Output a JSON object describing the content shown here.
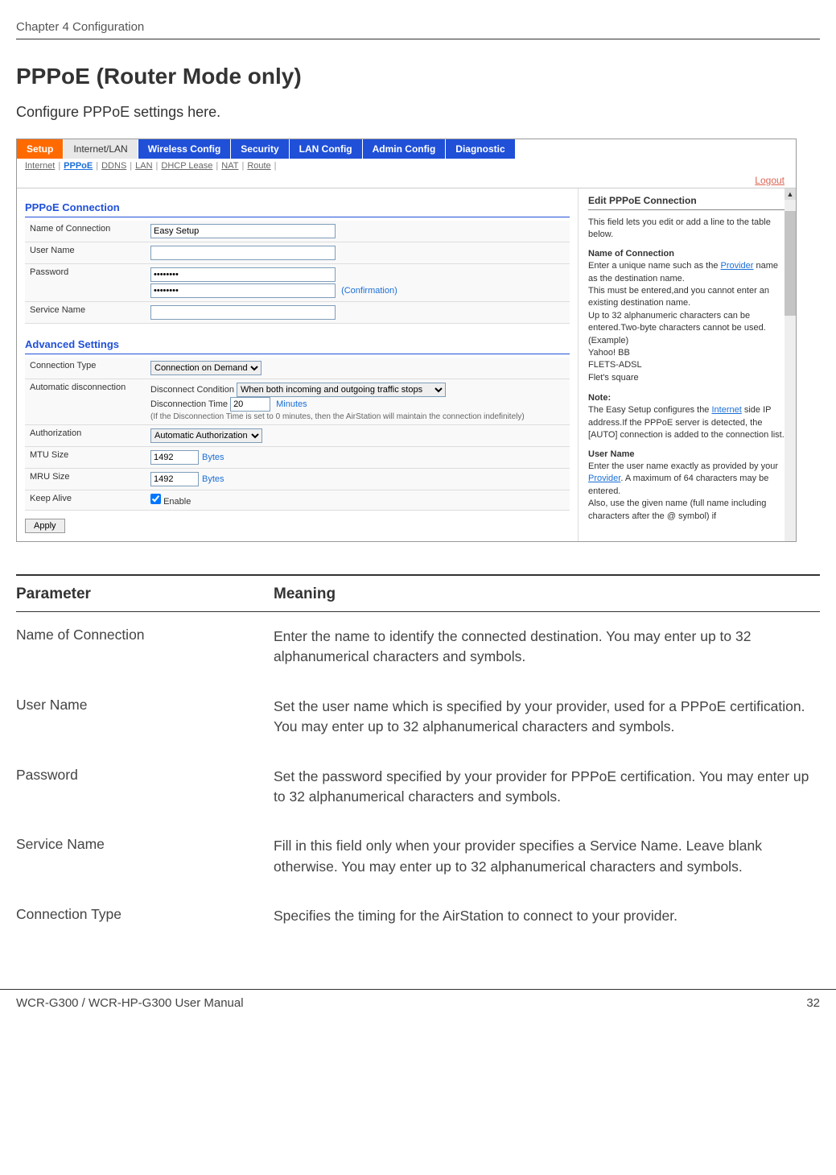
{
  "header": {
    "chapter": "Chapter 4  Configuration"
  },
  "section": {
    "title": "PPPoE (Router Mode only)",
    "intro": "Configure PPPoE settings here."
  },
  "screenshot": {
    "main_tabs": [
      "Setup",
      "Internet/LAN",
      "Wireless Config",
      "Security",
      "LAN Config",
      "Admin Config",
      "Diagnostic"
    ],
    "active_main_tab": 1,
    "sub_tabs": [
      "Internet",
      "PPPoE",
      "DDNS",
      "LAN",
      "DHCP Lease",
      "NAT",
      "Route"
    ],
    "active_sub_tab": 1,
    "logout": "Logout",
    "form": {
      "connection_title": "PPPoE Connection",
      "name_label": "Name of Connection",
      "name_value": "Easy Setup",
      "user_label": "User Name",
      "user_value": "",
      "password_label": "Password",
      "password_value": "••••••••",
      "password_confirm": "••••••••",
      "confirm_suffix": "(Confirmation)",
      "service_label": "Service Name",
      "service_value": "",
      "advanced_title": "Advanced Settings",
      "conn_type_label": "Connection Type",
      "conn_type_value": "Connection on Demand",
      "auto_disc_label": "Automatic disconnection",
      "disc_cond_label": "Disconnect Condition",
      "disc_cond_value": "When both incoming and outgoing traffic stops",
      "disc_time_label": "Disconnection Time",
      "disc_time_value": "20",
      "disc_time_units": "Minutes",
      "disc_note": "(If the Disconnection Time is set to 0 minutes, then the AirStation will maintain the connection indefinitely)",
      "auth_label": "Authorization",
      "auth_value": "Automatic Authorization",
      "mtu_label": "MTU Size",
      "mtu_value": "1492",
      "mtu_units": "Bytes",
      "mru_label": "MRU Size",
      "mru_value": "1492",
      "mru_units": "Bytes",
      "keep_label": "Keep Alive",
      "keep_enable": "Enable",
      "apply": "Apply"
    },
    "help": {
      "title": "Edit PPPoE Connection",
      "intro": "This field lets you edit or add a line to the table below.",
      "name_title": "Name of Connection",
      "name_body1": "Enter a unique name such as the ",
      "name_link1": "Provider",
      "name_body2": " name as the destination name.",
      "name_body3": "This must be entered,and you cannot enter an existing destination name.",
      "name_body4": "Up to 32 alphanumeric characters can be entered.Two-byte characters cannot be used.",
      "name_examples_label": "(Example)",
      "name_examples": "Yahoo! BB\nFLETS-ADSL\nFlet's square",
      "note_label": "Note:",
      "note_body": "The Easy Setup configures the ",
      "note_link": "Internet",
      "note_body2": " side IP address.If the PPPoE server is detected, the [AUTO] connection is added to the connection list.",
      "user_title": "User Name",
      "user_body1": "Enter the user name exactly as provided by your ",
      "user_link": "Provider",
      "user_body2": ". A maximum of 64 characters may be entered.",
      "user_body3": "Also, use the given name (full name including",
      "user_cutoff": "characters after the @ symbol) if"
    }
  },
  "params": {
    "h1": "Parameter",
    "h2": "Meaning",
    "rows": [
      {
        "name": "Name of Connection",
        "meaning": "Enter the name to identify the connected destination. You may enter up to 32 alphanumerical characters and symbols."
      },
      {
        "name": "User Name",
        "meaning": "Set the user name which is specified by your provider, used for a PPPoE certification. You may enter up to 32 alphanumerical characters and symbols."
      },
      {
        "name": "Password",
        "meaning": "Set the password specified by your provider for PPPoE certification. You may enter up to 32 alphanumerical characters and symbols."
      },
      {
        "name": "Service Name",
        "meaning": "Fill in this field only when your provider specifies a Service Name. Leave blank otherwise. You may enter up to 32 alphanumerical characters and symbols."
      },
      {
        "name": "Connection Type",
        "meaning": "Specifies the timing for the AirStation to connect to your provider."
      }
    ]
  },
  "footer": {
    "manual": "WCR-G300 / WCR-HP-G300 User Manual",
    "page": "32"
  }
}
